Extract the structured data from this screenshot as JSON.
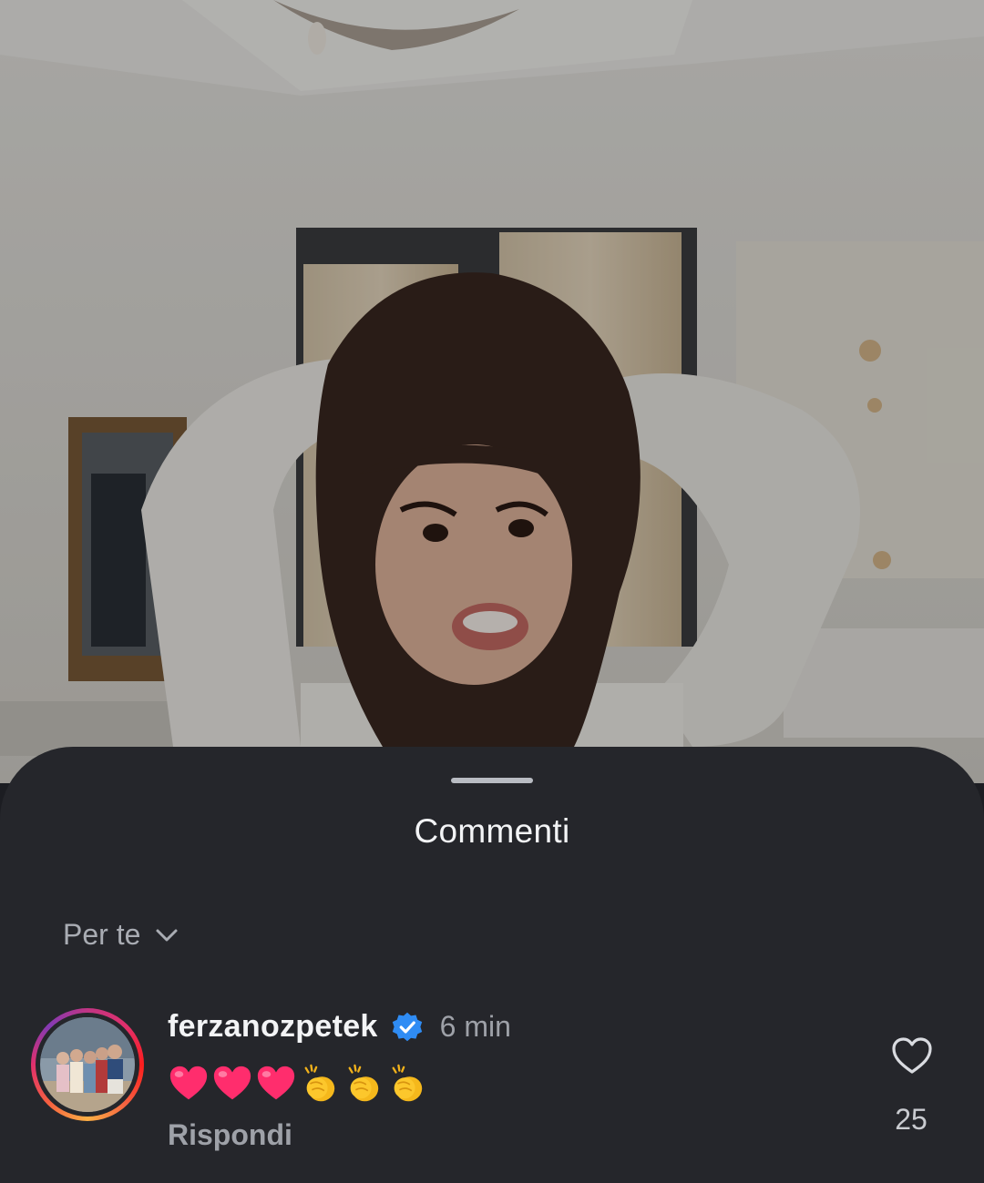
{
  "post_image": {
    "alt_semantic": "photo"
  },
  "sheet": {
    "title": "Commenti",
    "filter_label": "Per te",
    "filter_icon": "chevron-down-icon"
  },
  "comments": [
    {
      "username": "ferzanozpetek",
      "verified": true,
      "time": "6 min",
      "text_emojis": [
        "red-heart",
        "red-heart",
        "red-heart",
        "clapping-hands",
        "clapping-hands",
        "clapping-hands"
      ],
      "reply_label": "Rispondi",
      "like_count": "25",
      "like_icon": "heart-outline-icon"
    }
  ],
  "colors": {
    "sheet_bg": "#25262b",
    "verified_blue": "#2f8cf4",
    "heart_pink": "#ff2d6d"
  }
}
